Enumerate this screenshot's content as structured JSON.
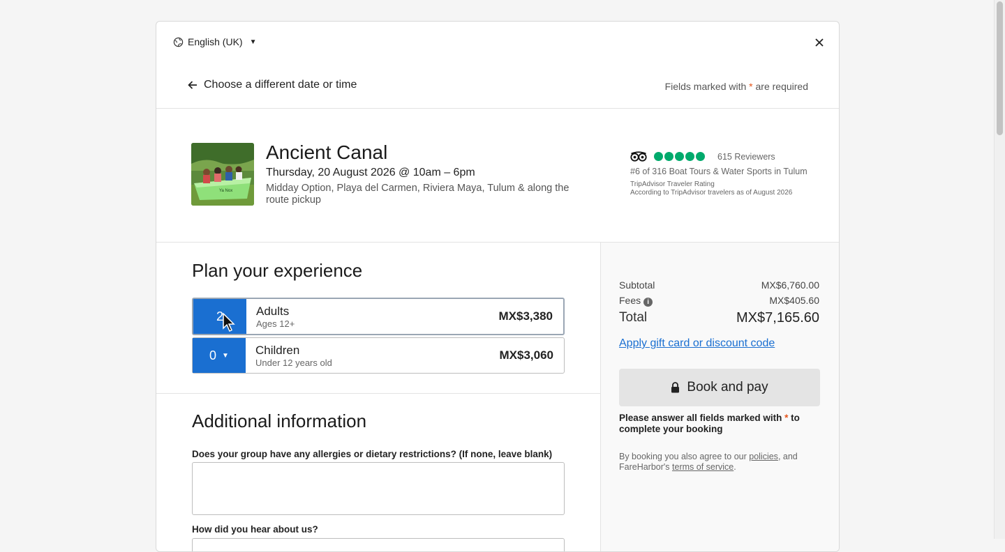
{
  "header": {
    "language": "English (UK)",
    "back_label": "Choose a different date or time",
    "required_prefix": "Fields marked with",
    "required_star": "*",
    "required_suffix": "are required"
  },
  "item": {
    "title": "Ancient Canal",
    "datetime": "Thursday, 20 August 2026 @ 10am – 6pm",
    "location": "Midday Option, Playa del Carmen, Riviera Maya, Tulum & along the route pickup"
  },
  "tripadvisor": {
    "rating_bubbles": 5,
    "reviewers": "615 Reviewers",
    "rank": "#6 of 316 Boat Tours & Water Sports in Tulum",
    "caption": "TripAdvisor Traveler Rating",
    "according": "According to TripAdvisor travelers as of August 2026",
    "bubble_color": "#00aa6c"
  },
  "plan": {
    "heading": "Plan your experience",
    "rows": [
      {
        "qty": "2",
        "label": "Adults",
        "sub": "Ages 12+",
        "price": "MX$3,380"
      },
      {
        "qty": "0",
        "label": "Children",
        "sub": "Under 12 years old",
        "price": "MX$3,060"
      }
    ]
  },
  "additional": {
    "heading": "Additional information",
    "q1": "Does your group have any allergies or dietary restrictions? (If none, leave blank)",
    "q1_value": "",
    "q2": "How did you hear about us?"
  },
  "summary": {
    "subtotal_label": "Subtotal",
    "subtotal": "MX$6,760.00",
    "fees_label": "Fees",
    "fees": "MX$405.60",
    "total_label": "Total",
    "total": "MX$7,165.60",
    "gift_link": "Apply gift card or discount code",
    "book_button": "Book and pay",
    "answer_prefix": "Please answer all fields marked with",
    "answer_suffix": "to complete your booking",
    "legal_1": "By booking you also agree to our",
    "policies": "policies",
    "legal_2": ", and FareHarbor's",
    "terms": "terms of service",
    "legal_3": "."
  },
  "colors": {
    "accent": "#1a6fd1",
    "required": "#e5531a"
  }
}
